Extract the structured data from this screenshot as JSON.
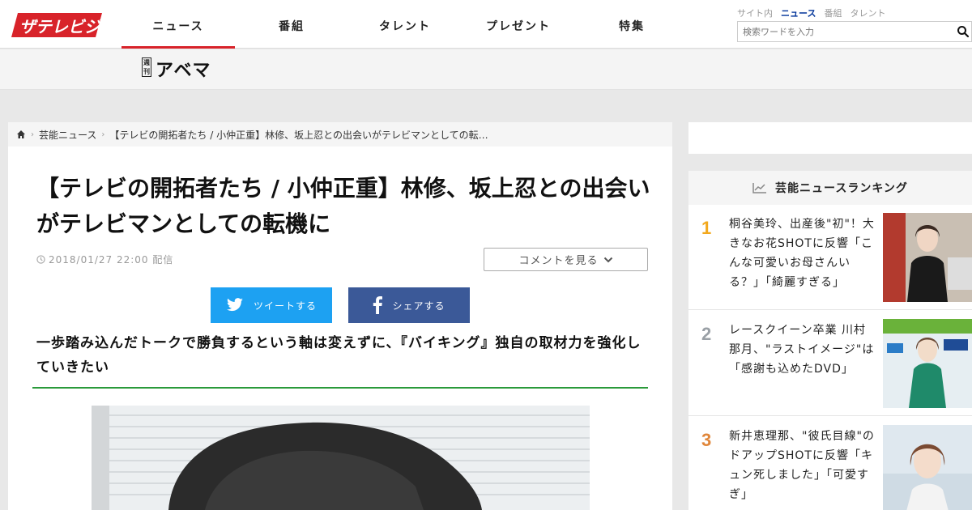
{
  "site": {
    "logo_text": "ザテレビジョン"
  },
  "nav": {
    "items": [
      {
        "label": "ニュース",
        "active": true
      },
      {
        "label": "番組",
        "active": false
      },
      {
        "label": "タレント",
        "active": false
      },
      {
        "label": "プレゼント",
        "active": false
      },
      {
        "label": "特集",
        "active": false
      }
    ]
  },
  "search": {
    "tabs": [
      "サイト内",
      "ニュース",
      "番組",
      "タレント"
    ],
    "active_tab": "ニュース",
    "placeholder": "検索ワードを入力"
  },
  "banner": {
    "badge": "週刊",
    "title": "アベマ"
  },
  "breadcrumb": {
    "category": "芸能ニュース",
    "current": "【テレビの開拓者たち / 小仲正重】林修、坂上忍との出会いがテレビマンとしての転…"
  },
  "article": {
    "title": "【テレビの開拓者たち / 小仲正重】林修、坂上忍との出会いがテレビマンとしての転機に",
    "date": "2018/01/27 22:00 配信",
    "comment_button": "コメントを見る",
    "tweet_button": "ツイートする",
    "share_button": "シェアする",
    "lead": "一歩踏み込んだトークで勝負するという軸は変えずに、『バイキング』独自の取材力を強化していきたい"
  },
  "ranking": {
    "title": "芸能ニュースランキング",
    "items": [
      {
        "rank": "1",
        "color": "#f2a81d",
        "text": "桐谷美玲、出産後\"初\"！大きなお花SHOTに反響「こんな可愛いお母さんいる？」「綺麗すぎる」"
      },
      {
        "rank": "2",
        "color": "#9aa0a6",
        "text": "レースクイーン卒業 川村那月、\"ラストイメージ\"は「感謝も込めたDVD」"
      },
      {
        "rank": "3",
        "color": "#e0863a",
        "text": "新井恵理那、\"彼氏目線\"のドアップSHOTに反響「キュン死しました」「可愛すぎ」"
      }
    ]
  },
  "colors": {
    "accent_red": "#d8232a",
    "twitter": "#1da1f2",
    "facebook": "#3b5998",
    "rule_green": "#2a9a3a"
  }
}
